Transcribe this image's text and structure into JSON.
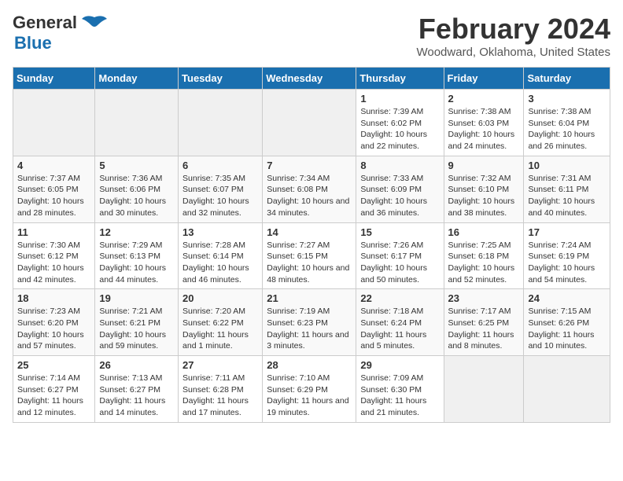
{
  "header": {
    "logo_line1": "General",
    "logo_line2": "Blue",
    "title": "February 2024",
    "subtitle": "Woodward, Oklahoma, United States"
  },
  "days_of_week": [
    "Sunday",
    "Monday",
    "Tuesday",
    "Wednesday",
    "Thursday",
    "Friday",
    "Saturday"
  ],
  "weeks": [
    [
      {
        "day": "",
        "empty": true
      },
      {
        "day": "",
        "empty": true
      },
      {
        "day": "",
        "empty": true
      },
      {
        "day": "",
        "empty": true
      },
      {
        "day": "1",
        "sunrise": "7:39 AM",
        "sunset": "6:02 PM",
        "daylight": "10 hours and 22 minutes."
      },
      {
        "day": "2",
        "sunrise": "7:38 AM",
        "sunset": "6:03 PM",
        "daylight": "10 hours and 24 minutes."
      },
      {
        "day": "3",
        "sunrise": "7:38 AM",
        "sunset": "6:04 PM",
        "daylight": "10 hours and 26 minutes."
      }
    ],
    [
      {
        "day": "4",
        "sunrise": "7:37 AM",
        "sunset": "6:05 PM",
        "daylight": "10 hours and 28 minutes."
      },
      {
        "day": "5",
        "sunrise": "7:36 AM",
        "sunset": "6:06 PM",
        "daylight": "10 hours and 30 minutes."
      },
      {
        "day": "6",
        "sunrise": "7:35 AM",
        "sunset": "6:07 PM",
        "daylight": "10 hours and 32 minutes."
      },
      {
        "day": "7",
        "sunrise": "7:34 AM",
        "sunset": "6:08 PM",
        "daylight": "10 hours and 34 minutes."
      },
      {
        "day": "8",
        "sunrise": "7:33 AM",
        "sunset": "6:09 PM",
        "daylight": "10 hours and 36 minutes."
      },
      {
        "day": "9",
        "sunrise": "7:32 AM",
        "sunset": "6:10 PM",
        "daylight": "10 hours and 38 minutes."
      },
      {
        "day": "10",
        "sunrise": "7:31 AM",
        "sunset": "6:11 PM",
        "daylight": "10 hours and 40 minutes."
      }
    ],
    [
      {
        "day": "11",
        "sunrise": "7:30 AM",
        "sunset": "6:12 PM",
        "daylight": "10 hours and 42 minutes."
      },
      {
        "day": "12",
        "sunrise": "7:29 AM",
        "sunset": "6:13 PM",
        "daylight": "10 hours and 44 minutes."
      },
      {
        "day": "13",
        "sunrise": "7:28 AM",
        "sunset": "6:14 PM",
        "daylight": "10 hours and 46 minutes."
      },
      {
        "day": "14",
        "sunrise": "7:27 AM",
        "sunset": "6:15 PM",
        "daylight": "10 hours and 48 minutes."
      },
      {
        "day": "15",
        "sunrise": "7:26 AM",
        "sunset": "6:17 PM",
        "daylight": "10 hours and 50 minutes."
      },
      {
        "day": "16",
        "sunrise": "7:25 AM",
        "sunset": "6:18 PM",
        "daylight": "10 hours and 52 minutes."
      },
      {
        "day": "17",
        "sunrise": "7:24 AM",
        "sunset": "6:19 PM",
        "daylight": "10 hours and 54 minutes."
      }
    ],
    [
      {
        "day": "18",
        "sunrise": "7:23 AM",
        "sunset": "6:20 PM",
        "daylight": "10 hours and 57 minutes."
      },
      {
        "day": "19",
        "sunrise": "7:21 AM",
        "sunset": "6:21 PM",
        "daylight": "10 hours and 59 minutes."
      },
      {
        "day": "20",
        "sunrise": "7:20 AM",
        "sunset": "6:22 PM",
        "daylight": "11 hours and 1 minute."
      },
      {
        "day": "21",
        "sunrise": "7:19 AM",
        "sunset": "6:23 PM",
        "daylight": "11 hours and 3 minutes."
      },
      {
        "day": "22",
        "sunrise": "7:18 AM",
        "sunset": "6:24 PM",
        "daylight": "11 hours and 5 minutes."
      },
      {
        "day": "23",
        "sunrise": "7:17 AM",
        "sunset": "6:25 PM",
        "daylight": "11 hours and 8 minutes."
      },
      {
        "day": "24",
        "sunrise": "7:15 AM",
        "sunset": "6:26 PM",
        "daylight": "11 hours and 10 minutes."
      }
    ],
    [
      {
        "day": "25",
        "sunrise": "7:14 AM",
        "sunset": "6:27 PM",
        "daylight": "11 hours and 12 minutes."
      },
      {
        "day": "26",
        "sunrise": "7:13 AM",
        "sunset": "6:27 PM",
        "daylight": "11 hours and 14 minutes."
      },
      {
        "day": "27",
        "sunrise": "7:11 AM",
        "sunset": "6:28 PM",
        "daylight": "11 hours and 17 minutes."
      },
      {
        "day": "28",
        "sunrise": "7:10 AM",
        "sunset": "6:29 PM",
        "daylight": "11 hours and 19 minutes."
      },
      {
        "day": "29",
        "sunrise": "7:09 AM",
        "sunset": "6:30 PM",
        "daylight": "11 hours and 21 minutes."
      },
      {
        "day": "",
        "empty": true
      },
      {
        "day": "",
        "empty": true
      }
    ]
  ]
}
